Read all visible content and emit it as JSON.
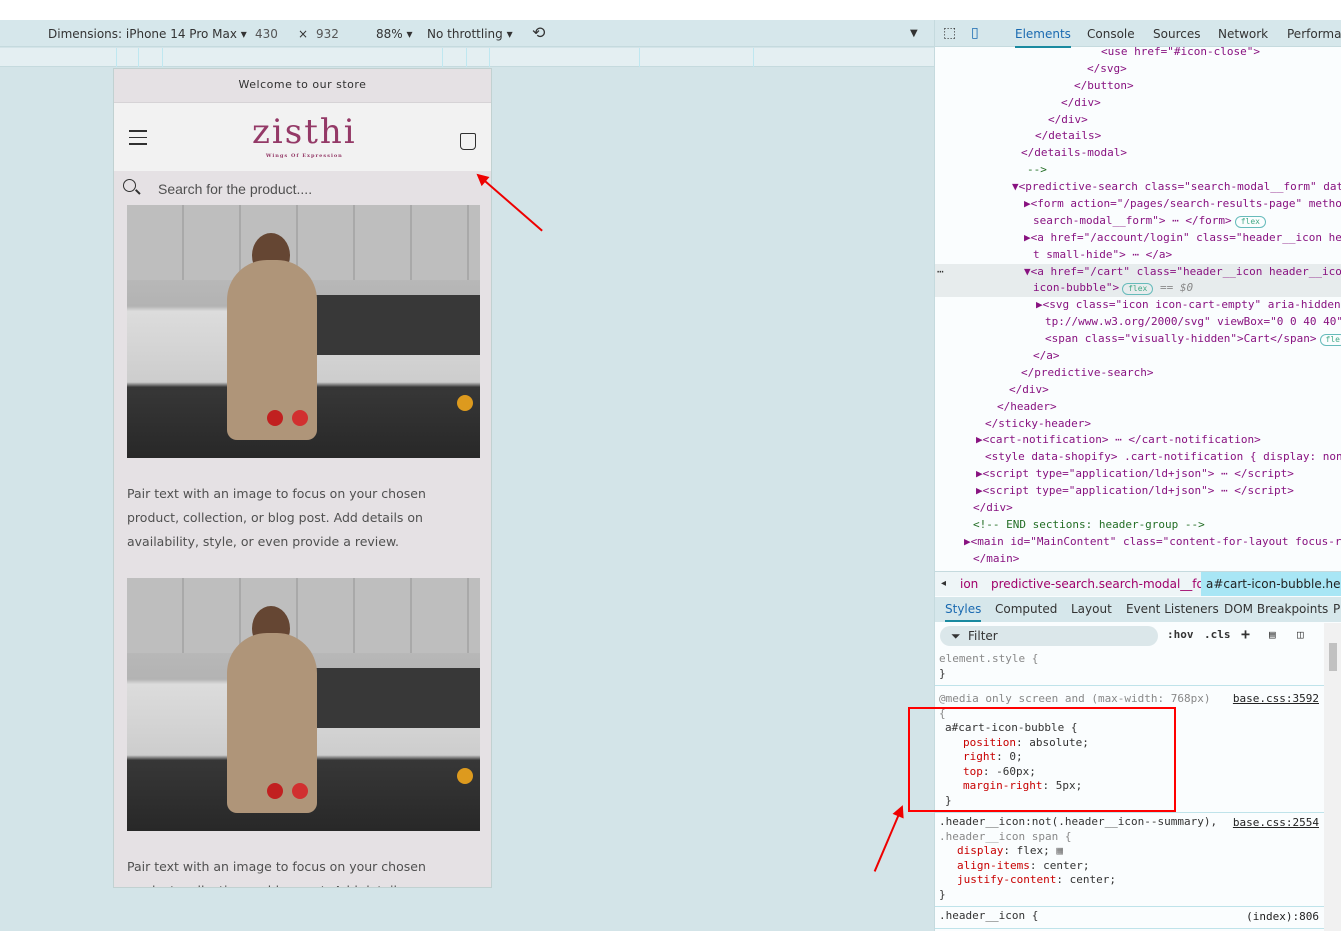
{
  "device_toolbar": {
    "dimensions_label": "Dimensions: iPhone 14 Pro Max",
    "width": "430",
    "times": "×",
    "height": "932",
    "zoom": "88%",
    "throttling": "No throttling"
  },
  "page": {
    "announcement": "Welcome to our store",
    "logo_text": "zisthi",
    "logo_tagline": "Wings Of Expression",
    "search_placeholder": "Search for the product....",
    "description": "Pair text with an image to focus on your chosen product, collection, or blog post. Add details on availability, style, or even provide a review.",
    "description2": "Pair text with an image to focus on your chosen product, collection, or blog post. Add details on availability, style,"
  },
  "devtools": {
    "tabs": [
      "Elements",
      "Console",
      "Sources",
      "Network",
      "Performan"
    ],
    "dom_lines": [
      "<use href=\"#icon-close\">",
      "</svg>",
      "</button>",
      "</div>",
      "</div>",
      "</details>",
      "</details-modal>",
      "-->",
      "▼<predictive-search class=\"search-modal__form\" dat",
      "▶<form action=\"/pages/search-results-page\" metho",
      "search-modal__form\"> ⋯ </form>",
      "▶<a href=\"/account/login\" class=\"header__icon he",
      "t small-hide\"> ⋯ </a>",
      "▼<a href=\"/cart\" class=\"header__icon header__ico",
      "icon-bubble\">",
      "▶<svg class=\"icon icon-cart-empty\" aria-hidden",
      "tp://www.w3.org/2000/svg\" viewBox=\"0 0 40 40\"",
      "<span class=\"visually-hidden\">Cart</span>",
      "</a>",
      "</predictive-search>",
      "</div>",
      "</header>",
      "</sticky-header>",
      "▶<cart-notification> ⋯ </cart-notification>",
      "<style data-shopify> .cart-notification { display: non",
      "▶<script type=\"application/ld+json\"> ⋯ </script>",
      "▶<script type=\"application/ld+json\"> ⋯ </script>",
      "</div>",
      "<!-- END sections: header-group -->",
      "▶<main id=\"MainContent\" class=\"content-for-layout focus-r",
      "</main>"
    ],
    "badge_flex": "flex",
    "badge_fle": "fle",
    "selected_marker": "== $0",
    "row_dots": "⋯",
    "breadcrumbs": [
      "ion",
      "predictive-search.search-modal__form",
      "a#cart-icon-bubble.heade"
    ],
    "subtabs": [
      "Styles",
      "Computed",
      "Layout",
      "Event Listeners",
      "DOM Breakpoints",
      "P"
    ],
    "filter_placeholder": "Filter",
    "hov": ":hov",
    "cls": ".cls",
    "rules": {
      "element_style": "element.style {",
      "close": "}",
      "media": "@media only screen and (max-width: 768px)",
      "media_src": "base.css:3592",
      "open": "{",
      "selector1": "a#cart-icon-bubble {",
      "props1": [
        [
          "position",
          "absolute;"
        ],
        [
          "right",
          "0;"
        ],
        [
          "top",
          "-60px;"
        ],
        [
          "margin-right",
          "5px;"
        ]
      ],
      "selector2a": ".header__icon:not(.header__icon--summary),",
      "selector2b": ".header__icon span {",
      "src2": "base.css:2554",
      "props2": [
        [
          "display",
          "flex;"
        ],
        [
          "align-items",
          "center;"
        ],
        [
          "justify-content",
          "center;"
        ]
      ],
      "selector3": ".header__icon {",
      "src3": "(index):806"
    }
  }
}
